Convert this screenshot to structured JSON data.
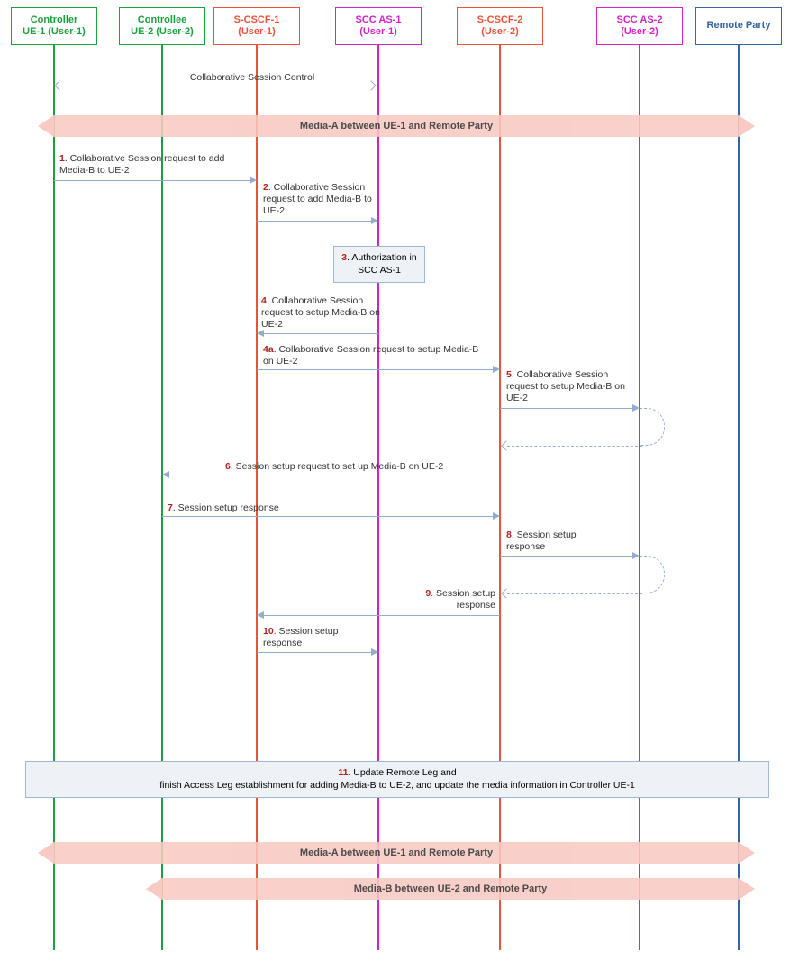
{
  "lanes": {
    "ue1": {
      "l1": "Controller",
      "l2": "UE-1 (User-1)"
    },
    "ue2": {
      "l1": "Controllee",
      "l2": "UE-2 (User-2)"
    },
    "scscf1": {
      "l1": "S-CSCF-1",
      "l2": "(User-1)"
    },
    "sccas1": {
      "l1": "SCC AS-1",
      "l2": "(User-1)"
    },
    "scscf2": {
      "l1": "S-CSCF-2",
      "l2": "(User-2)"
    },
    "sccas2": {
      "l1": "SCC AS-2",
      "l2": "(User-2)"
    },
    "remote": {
      "l1": "Remote Party",
      "l2": ""
    }
  },
  "top_ctrl": "Collaborative Session Control",
  "media": {
    "a1": "Media-A between UE-1 and Remote Party",
    "a2": "Media-A between UE-1 and Remote Party",
    "b": "Media-B between UE-2 and Remote Party"
  },
  "msgs": {
    "m1": {
      "n": "1",
      "t": ". Collaborative Session request to add Media-B to UE-2"
    },
    "m2": {
      "n": "2",
      "t": ". Collaborative Session request to add Media-B to UE-2"
    },
    "m3": {
      "n": "3",
      "t": ". Authorization in SCC AS-1"
    },
    "m4": {
      "n": "4",
      "t": ". Collaborative Session request to setup Media-B on UE-2"
    },
    "m4a": {
      "n": "4a",
      "t": ". Collaborative Session request to setup Media-B on UE-2"
    },
    "m5": {
      "n": "5",
      "t": ". Collaborative Session request to setup Media-B on UE-2"
    },
    "m6": {
      "n": "6",
      "t": ". Session setup request to set up Media-B on UE-2"
    },
    "m7": {
      "n": "7",
      "t": ". Session setup response"
    },
    "m8": {
      "n": "8",
      "t": ". Session setup response"
    },
    "m9": {
      "n": "9",
      "t": ". Session setup response"
    },
    "m10": {
      "n": "10",
      "t": ". Session setup response"
    },
    "m11": {
      "n": "11",
      "t1": ". Update Remote Leg and",
      "t2": "finish Access Leg establishment for adding Media-B to UE-2, and update the media information in Controller UE-1"
    }
  }
}
